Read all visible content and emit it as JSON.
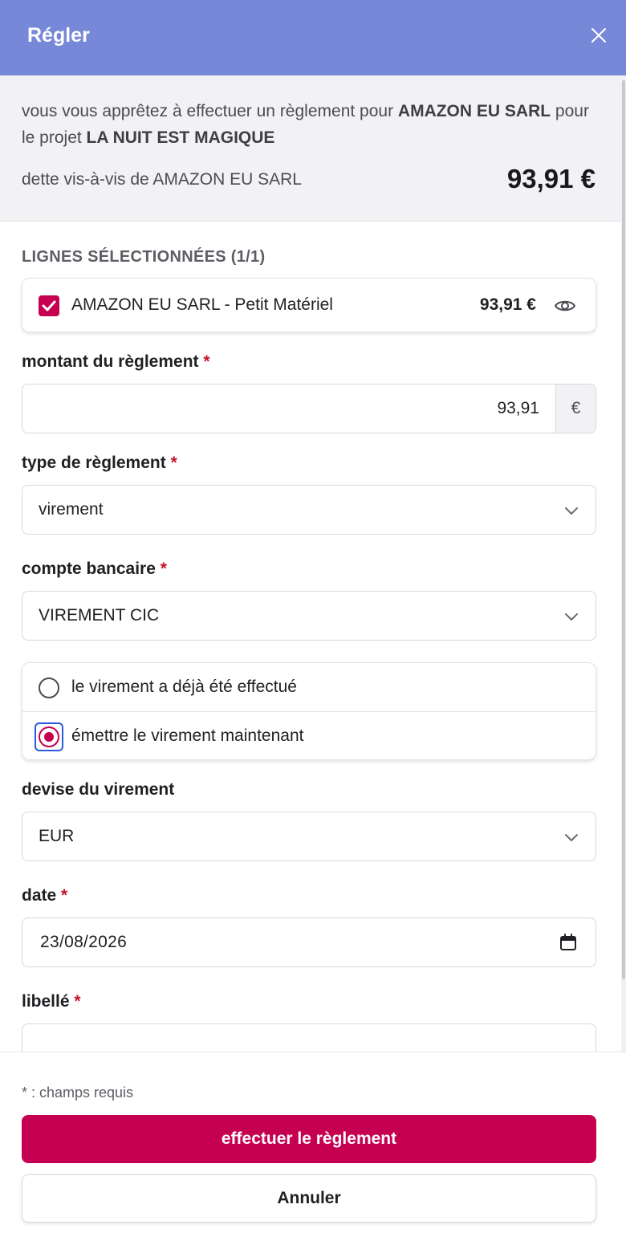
{
  "header": {
    "title": "Régler"
  },
  "summary": {
    "prefix": "vous vous apprêtez à effectuer un règlement pour ",
    "supplier": "AMAZON EU SARL",
    "middle": " pour le projet ",
    "project": "LA NUIT EST MAGIQUE",
    "debt_label": "dette vis-à-vis de AMAZON EU SARL",
    "debt_amount": "93,91 €"
  },
  "selected_lines": {
    "title": "LIGNES SÉLECTIONNÉES (1/1)",
    "items": [
      {
        "label": "AMAZON EU SARL - Petit Matériel",
        "amount": "93,91 €",
        "checked": true
      }
    ]
  },
  "form": {
    "required_mark": "*",
    "amount": {
      "label": "montant du règlement",
      "value": "93,91",
      "currency": "€"
    },
    "payment_type": {
      "label": "type de règlement",
      "value": "virement"
    },
    "bank_account": {
      "label": "compte bancaire",
      "value": "VIREMENT CIC"
    },
    "transfer_options": [
      {
        "label": "le virement a déjà été effectué",
        "selected": false
      },
      {
        "label": "émettre le virement maintenant",
        "selected": true
      }
    ],
    "currency": {
      "label": "devise du virement",
      "value": "EUR"
    },
    "date": {
      "label": "date",
      "value": "23/08/2026"
    },
    "wording": {
      "label": "libellé",
      "value": ""
    }
  },
  "footer": {
    "required_note": "* : champs requis",
    "submit_label": "effectuer le règlement",
    "cancel_label": "Annuler"
  },
  "colors": {
    "header_bg": "#7888d8",
    "accent": "#c60050",
    "required": "#c3162a",
    "focus_ring": "#2b5bd8"
  }
}
